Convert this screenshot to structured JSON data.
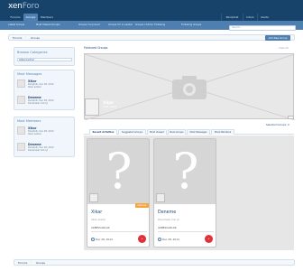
{
  "header": {
    "logo_main": "xen",
    "logo_accent": "Foro"
  },
  "nav": {
    "tabs": [
      "Forums",
      "Groups",
      "Members"
    ],
    "user_tabs": [
      "Paniptolk",
      "Inbox",
      "Alerts"
    ],
    "sublinks": [
      "Latest Groups",
      "Most Viewed Groups",
      "Groups I've Joined",
      "Groups I'm in Leader",
      "Groups I Admin",
      "Following",
      "Following Groups"
    ],
    "search_placeholder": "Search..."
  },
  "breadcrumb": {
    "items": [
      "Forums",
      "Groups"
    ]
  },
  "add_button": "Add New Group",
  "sidebar": {
    "categories": {
      "title": "Browse Categories",
      "selected": "Alliancechar"
    },
    "most_messages": {
      "title": "Most Messages",
      "items": [
        {
          "name": "Xikar",
          "meta": "Paniptolk, Dec 28, 2014",
          "desc": "Xikar aciklar"
        },
        {
          "name": "Deneme",
          "meta": "Paniptolk, Dec 28, 2014",
          "desc": "Denemeler Cok Iyi"
        }
      ]
    },
    "most_members": {
      "title": "Most Members",
      "items": [
        {
          "name": "Xikar",
          "meta": "Paniptolk, Dec 28, 2014",
          "desc": "Xikar aciklar"
        },
        {
          "name": "Deneme",
          "meta": "Paniptolk, Dec 28, 2014",
          "desc": "Denemeler Cok Iyi"
        }
      ]
    }
  },
  "main": {
    "featured_title": "Featured Groups",
    "view_all": "View All",
    "featured": {
      "name": "Xikar",
      "desc": "Xikar aciklar"
    },
    "selected_label": "Selected Groups: 0",
    "tabs": [
      "Recent Activities",
      "Suggested Groups",
      "Most Viewed",
      "New Groups",
      "Most Messages",
      "Most Members"
    ],
    "cards": [
      {
        "title": "Xikar",
        "desc": "Xikar aciklar",
        "author": "AKBESUARLAR",
        "date": "Dec 28, 2014",
        "badge": "Featured",
        "join": "+"
      },
      {
        "title": "Deneme",
        "desc": "Denemeler Cok Iyi",
        "author": "AKBESUARLAR",
        "date": "Dec 28, 2014",
        "badge": "",
        "join": "+"
      }
    ]
  },
  "footer_crumb": {
    "items": [
      "Forums",
      "Groups"
    ]
  },
  "colors": {
    "header": "#17426a",
    "accent": "#4e7fb0",
    "join": "#e0303a",
    "badge": "#f6a33a"
  }
}
